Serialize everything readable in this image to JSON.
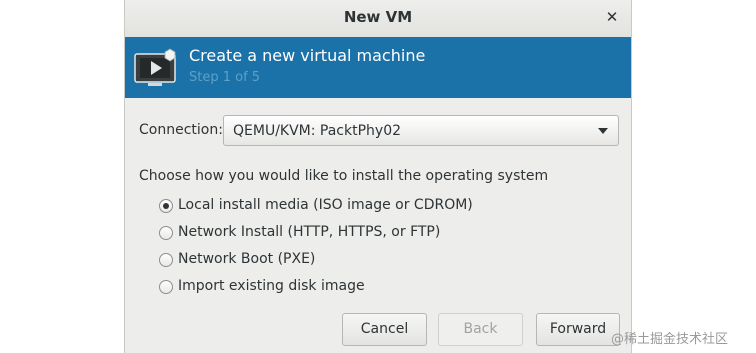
{
  "window": {
    "title": "New VM",
    "close_glyph": "✕"
  },
  "banner": {
    "icon": "virtual-machine-icon",
    "title": "Create a new virtual machine",
    "step": "Step 1 of 5",
    "background": "#1a72a8"
  },
  "connection": {
    "label": "Connection:",
    "selected": "QEMU/KVM: PacktPhy02"
  },
  "install": {
    "prompt": "Choose how you would like to install the operating system",
    "options": [
      {
        "label": "Local install media (ISO image or CDROM)",
        "checked": true
      },
      {
        "label": "Network Install (HTTP, HTTPS, or FTP)",
        "checked": false
      },
      {
        "label": "Network Boot (PXE)",
        "checked": false
      },
      {
        "label": "Import existing disk image",
        "checked": false
      }
    ]
  },
  "buttons": {
    "cancel": "Cancel",
    "back": "Back",
    "forward": "Forward",
    "back_enabled": false
  },
  "watermark": "@稀土掘金技术社区"
}
